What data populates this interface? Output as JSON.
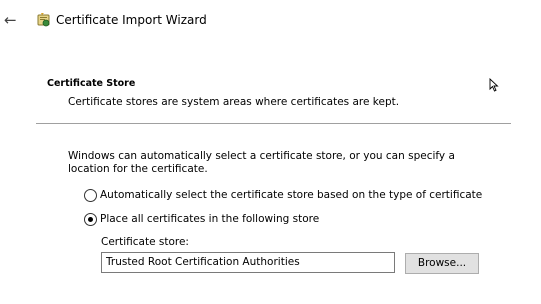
{
  "window": {
    "title": "Certificate Import Wizard"
  },
  "section": {
    "heading": "Certificate Store",
    "description": "Certificate stores are system areas where certificates are kept."
  },
  "main": {
    "instructions": "Windows can automatically select a certificate store, or you can specify a location for the certificate.",
    "options": [
      {
        "label": "Automatically select the certificate store based on the type of certificate",
        "selected": false
      },
      {
        "label": "Place all certificates in the following store",
        "selected": true
      }
    ],
    "store_label": "Certificate store:",
    "store_value": "Trusted Root Certification Authorities",
    "browse_label": "Browse..."
  },
  "icons": {
    "back": "back-arrow-icon",
    "wizard": "certificate-wizard-icon",
    "cursor": "mouse-pointer-icon"
  }
}
